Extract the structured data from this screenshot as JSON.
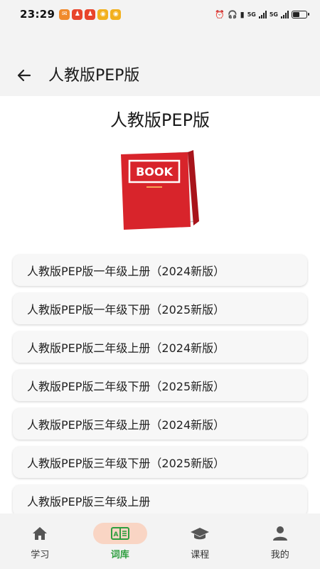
{
  "status_bar": {
    "time": "23:29",
    "network_1": "5G",
    "network_2": "5G"
  },
  "header": {
    "title": "人教版PEP版"
  },
  "page": {
    "heading": "人教版PEP版",
    "book_cover_text": "BOOK"
  },
  "books": [
    {
      "label": "人教版PEP版一年级上册（2024新版）"
    },
    {
      "label": "人教版PEP版一年级下册（2025新版）"
    },
    {
      "label": "人教版PEP版二年级上册（2024新版）"
    },
    {
      "label": "人教版PEP版二年级下册（2025新版）"
    },
    {
      "label": "人教版PEP版三年级上册（2024新版）"
    },
    {
      "label": "人教版PEP版三年级下册（2025新版）"
    },
    {
      "label": "人教版PEP版三年级上册"
    }
  ],
  "bottom_nav": [
    {
      "label": "学习",
      "icon": "home-icon",
      "active": false
    },
    {
      "label": "词库",
      "icon": "wordbook-icon",
      "active": true
    },
    {
      "label": "课程",
      "icon": "graduation-cap-icon",
      "active": false
    },
    {
      "label": "我的",
      "icon": "person-icon",
      "active": false
    }
  ],
  "colors": {
    "accent": "#2e9e3f",
    "nav_active_bg": "#f9d5c4",
    "book_red": "#d8242b"
  }
}
